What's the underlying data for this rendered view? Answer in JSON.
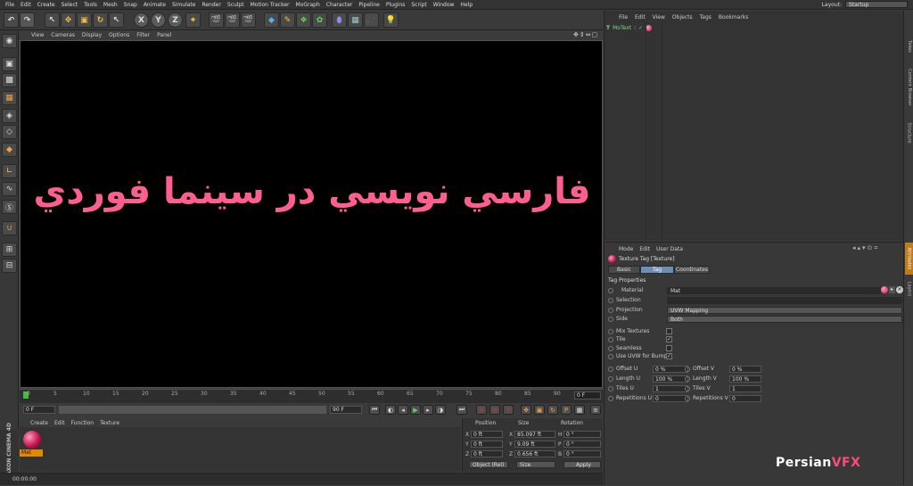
{
  "menubar": {
    "items": [
      "File",
      "Edit",
      "Create",
      "Select",
      "Tools",
      "Mesh",
      "Snap",
      "Animate",
      "Simulate",
      "Render",
      "Sculpt",
      "Motion Tracker",
      "MoGraph",
      "Character",
      "Pipeline",
      "Plugins",
      "Script",
      "Window",
      "Help"
    ],
    "layout_label": "Layout:",
    "layout_value": "Startup"
  },
  "toolbar": {
    "axis_x": "X",
    "axis_y": "Y",
    "axis_z": "Z"
  },
  "viewport": {
    "menu": [
      "View",
      "Cameras",
      "Display",
      "Options",
      "Filter",
      "Panel"
    ],
    "overlay_text": "فارسي نويسي در سينما فوردي"
  },
  "timeline": {
    "ticks": [
      "0",
      "5",
      "10",
      "15",
      "20",
      "25",
      "30",
      "35",
      "40",
      "45",
      "50",
      "55",
      "60",
      "65",
      "70",
      "75",
      "80",
      "85",
      "90"
    ],
    "end_frame": "0 F"
  },
  "transport": {
    "start": "0 F",
    "end": "90 F"
  },
  "material_manager": {
    "menu": [
      "Create",
      "Edit",
      "Function",
      "Texture"
    ],
    "material_name": "Mat"
  },
  "coordinates": {
    "headers": [
      "Position",
      "Size",
      "Rotation"
    ],
    "rows": [
      {
        "axis": "X",
        "pos": "0 ft",
        "size_axis": "X",
        "size": "85.097 ft",
        "rot_axis": "H",
        "rot": "0 °"
      },
      {
        "axis": "Y",
        "pos": "0 ft",
        "size_axis": "Y",
        "size": "9.09 ft",
        "rot_axis": "P",
        "rot": "0 °"
      },
      {
        "axis": "Z",
        "pos": "0 ft",
        "size_axis": "Z",
        "size": "0.656 ft",
        "rot_axis": "B",
        "rot": "0 °"
      }
    ],
    "mode": "Object (Rel)",
    "size_mode": "Size",
    "apply": "Apply"
  },
  "statusbar": {
    "time": "00:00:00"
  },
  "maxon": "MAXON CINEMA 4D",
  "object_manager": {
    "menu": [
      "File",
      "Edit",
      "View",
      "Objects",
      "Tags",
      "Bookmarks"
    ],
    "object_name": "MoText"
  },
  "side_tabs": [
    "Takes",
    "Content Browser",
    "Structure",
    "Attributes",
    "Layers"
  ],
  "attributes": {
    "menu": [
      "Mode",
      "Edit",
      "User Data"
    ],
    "title": "Texture Tag [Texture]",
    "tabs": [
      "Basic",
      "Tag",
      "Coordinates"
    ],
    "section": "Tag Properties",
    "material_label": "Material",
    "material_value": "Mat",
    "selection_label": "Selection",
    "projection_label": "Projection",
    "projection_value": "UVW Mapping",
    "side_label": "Side",
    "side_value": "Both",
    "mix_label": "Mix Textures",
    "tile_label": "Tile",
    "seamless_label": "Seamless",
    "uvw_label": "Use UVW for Bump",
    "offset_u_label": "Offset U",
    "offset_u": "0 %",
    "offset_v_label": "Offset V",
    "offset_v": "0 %",
    "length_u_label": "Length U",
    "length_u": "100 %",
    "length_v_label": "Length V",
    "length_v": "100 %",
    "tiles_u_label": "Tiles U",
    "tiles_u": "1",
    "tiles_v_label": "Tiles V",
    "tiles_v": "1",
    "rep_u_label": "Repetitions U",
    "rep_u": "0",
    "rep_v_label": "Repetitions V",
    "rep_v": "0"
  },
  "brand": {
    "part1": "Persian",
    "part2": "VFX"
  }
}
